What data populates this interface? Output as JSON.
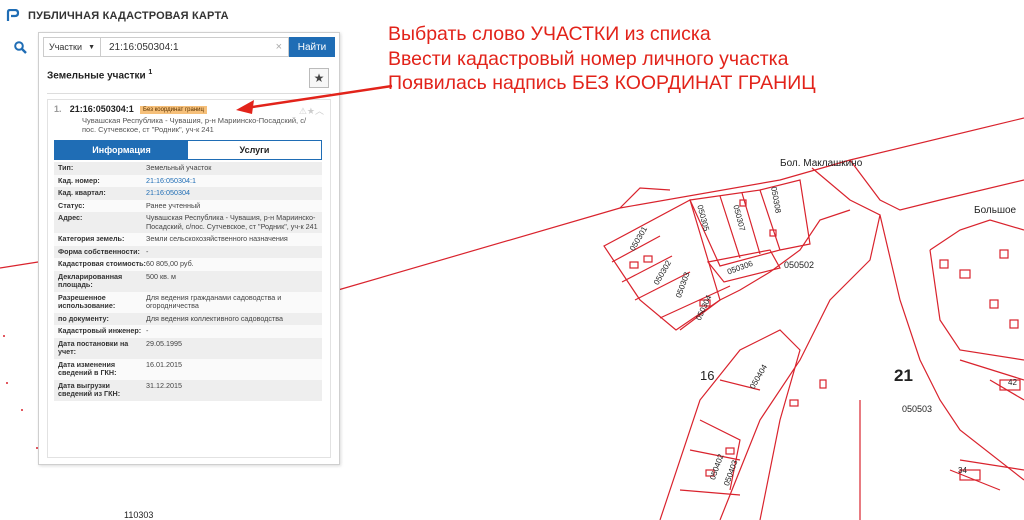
{
  "app": {
    "title": "ПУБЛИЧНАЯ КАДАСТРОВАЯ КАРТА"
  },
  "search": {
    "type_label": "Участки",
    "query": "21:16:050304:1",
    "button_label": "Найти"
  },
  "results": {
    "section_title": "Земельные участки",
    "count": "1",
    "item": {
      "index": "1.",
      "cadastral_number": "21:16:050304:1",
      "badge": "Без координат границ",
      "address": "Чувашская Республика - Чувашия, р-н Мариинско-Посадский, с/пос. Сутчевское, ст \"Родник\", уч-к 241"
    },
    "tabs": [
      {
        "label": "Информация"
      },
      {
        "label": "Услуги"
      }
    ],
    "info": [
      {
        "label": "Тип:",
        "value": "Земельный участок"
      },
      {
        "label": "Кад. номер:",
        "value": "21:16:050304:1",
        "link": true
      },
      {
        "label": "Кад. квартал:",
        "value": "21:16:050304",
        "link": true
      },
      {
        "label": "Статус:",
        "value": "Ранее учтенный"
      },
      {
        "label": "Адрес:",
        "value": "Чувашская Республика - Чувашия, р-н Мариинско-Посадский, с/пос. Сутчевское, ст \"Родник\", уч-к 241"
      },
      {
        "label": "Категория земель:",
        "value": "Земли сельскохозяйственного назначения"
      },
      {
        "label": "Форма собственности:",
        "value": "-"
      },
      {
        "label": "Кадастровая стоимость:",
        "value": "60 805,00 руб."
      },
      {
        "label": "Декларированная площадь:",
        "value": "500 кв. м"
      },
      {
        "label": "Разрешенное использование:",
        "value": "Для ведения гражданами садоводства и огородничества"
      },
      {
        "label": "по документу:",
        "value": "Для ведения коллективного садоводства"
      },
      {
        "label": "Кадастровый инженер:",
        "value": "-"
      },
      {
        "label": "Дата постановки на учет:",
        "value": "29.05.1995"
      },
      {
        "label": "Дата изменения сведений в ГКН:",
        "value": "16.01.2015"
      },
      {
        "label": "Дата выгрузки сведений из ГКН:",
        "value": "31.12.2015"
      }
    ]
  },
  "annotation": {
    "lines": [
      "Выбрать слово УЧАСТКИ из списка",
      "Ввести кадастровый номер личного участка",
      "Появилась надпись БЕЗ КООРДИНАТ ГРАНИЦ"
    ]
  },
  "map": {
    "labels": {
      "village1": "Бол. Маклашкино",
      "village2": "Большое",
      "q050301": "050301",
      "q050302": "050302",
      "q050303": "050303",
      "q050304": "050304",
      "q050305": "050305",
      "q050306": "050306",
      "q050307": "050307",
      "q050308": "050308",
      "q050502": "050502",
      "q050503": "050503",
      "q050402": "050402",
      "q050403": "050403",
      "q050404": "050404",
      "n16": "16",
      "n21": "21",
      "n42": "42",
      "n34": "34",
      "q110303": "110303"
    }
  },
  "colors": {
    "accent": "#1f6db5",
    "annotation": "#e2231a",
    "parcel": "#d9232d",
    "badge": "#f6c07a"
  }
}
